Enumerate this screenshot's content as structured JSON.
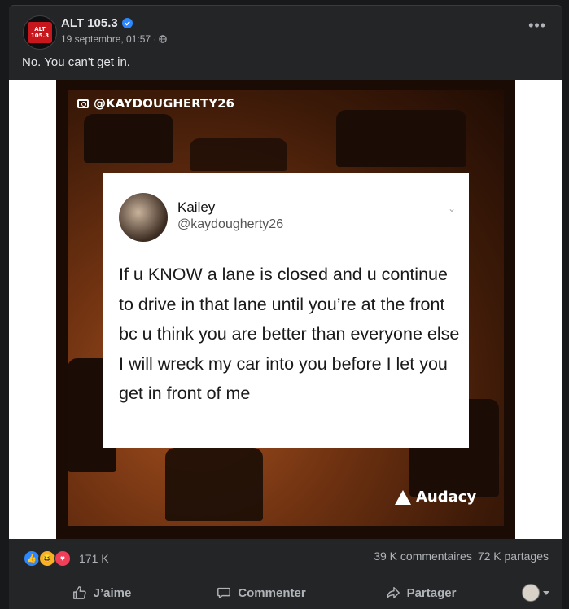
{
  "post": {
    "page_name": "ALT 105.3",
    "timestamp": "19 septembre, 01:57 ·",
    "caption": "No. You can't get in.",
    "avatar_text_top": "ALT",
    "avatar_text_bottom": "105.3"
  },
  "image": {
    "instagram_handle": "@KAYDOUGHERTY26",
    "tweet": {
      "name": "Kailey",
      "handle": "@kaydougherty26",
      "text": "If u KNOW a lane is closed and u continue to drive in that lane until you’re at the front bc u think you are better than everyone else I will wreck my car into you before I let you get in front of me"
    },
    "watermark": "Audacy"
  },
  "engagement": {
    "reaction_count": "171 K",
    "comments": "39 K commentaires",
    "shares": "72 K partages"
  },
  "actions": {
    "like": "J’aime",
    "comment": "Commenter",
    "share": "Partager"
  },
  "colors": {
    "background": "#18191a",
    "card": "#242526",
    "verified": "#2d88ff",
    "like": "#2d88ff",
    "haha": "#f7b125",
    "love": "#f33e58"
  },
  "icons": [
    "verified-icon",
    "globe-icon",
    "more-options-icon",
    "camera-icon",
    "chevron-down-icon",
    "like-reaction-icon",
    "haha-reaction-icon",
    "love-reaction-icon",
    "thumbs-up-icon",
    "comment-icon",
    "share-icon",
    "caret-down-icon"
  ]
}
